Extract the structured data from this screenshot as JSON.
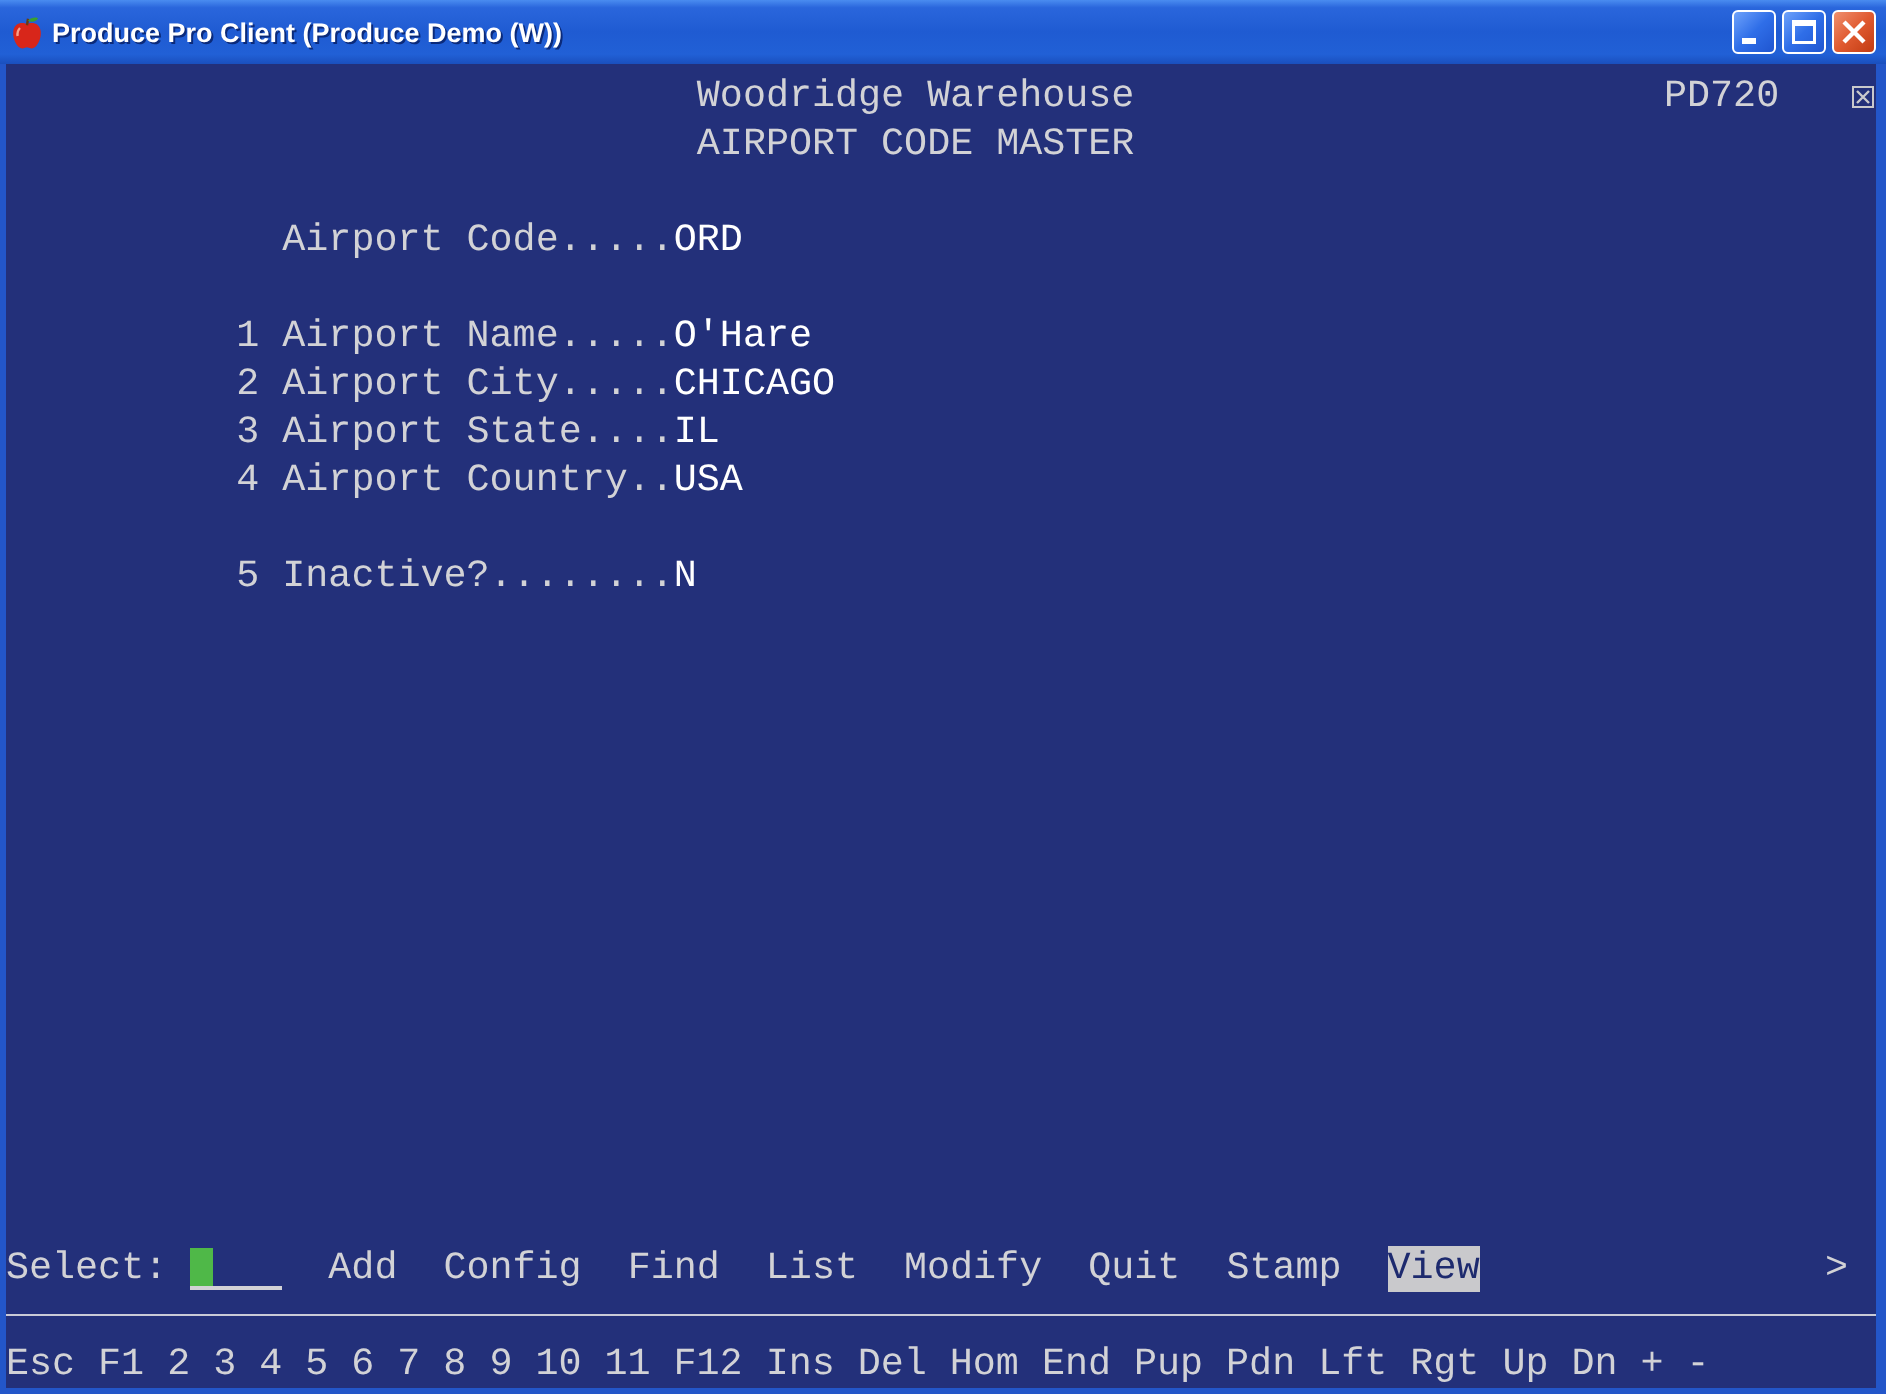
{
  "window": {
    "title": "Produce Pro Client (Produce Demo (W))"
  },
  "header": {
    "company": "Woodridge Warehouse",
    "program_id": "PD720",
    "screen_title": "AIRPORT CODE MASTER"
  },
  "groups": [
    {
      "fields": [
        {
          "label": "Airport Code.....",
          "value": "ORD"
        }
      ]
    },
    {
      "fields": [
        {
          "number": "1",
          "label": "Airport Name.....",
          "value": "O'Hare"
        },
        {
          "number": "2",
          "label": "Airport City.....",
          "value": "CHICAGO"
        },
        {
          "number": "3",
          "label": "Airport State....",
          "value": "IL"
        },
        {
          "number": "4",
          "label": "Airport Country..",
          "value": "USA"
        }
      ]
    },
    {
      "fields": [
        {
          "number": "5",
          "label": "Inactive?........",
          "value": "N"
        }
      ]
    }
  ],
  "select": {
    "label": "Select:"
  },
  "menu": [
    {
      "label": "Add",
      "selected": false
    },
    {
      "label": "Config",
      "selected": false
    },
    {
      "label": "Find",
      "selected": false
    },
    {
      "label": "List",
      "selected": false
    },
    {
      "label": "Modify",
      "selected": false
    },
    {
      "label": "Quit",
      "selected": false
    },
    {
      "label": "Stamp",
      "selected": false
    },
    {
      "label": "View",
      "selected": true
    }
  ],
  "more": ">",
  "function_keys": [
    "Esc",
    "F1",
    "2",
    "3",
    "4",
    "5",
    "6",
    "7",
    "8",
    "9",
    "10",
    "11",
    "F12",
    "Ins",
    "Del",
    "Hom",
    "End",
    "Pup",
    "Pdn",
    "Lft",
    "Rgt",
    "Up",
    "Dn",
    "+",
    "-"
  ]
}
